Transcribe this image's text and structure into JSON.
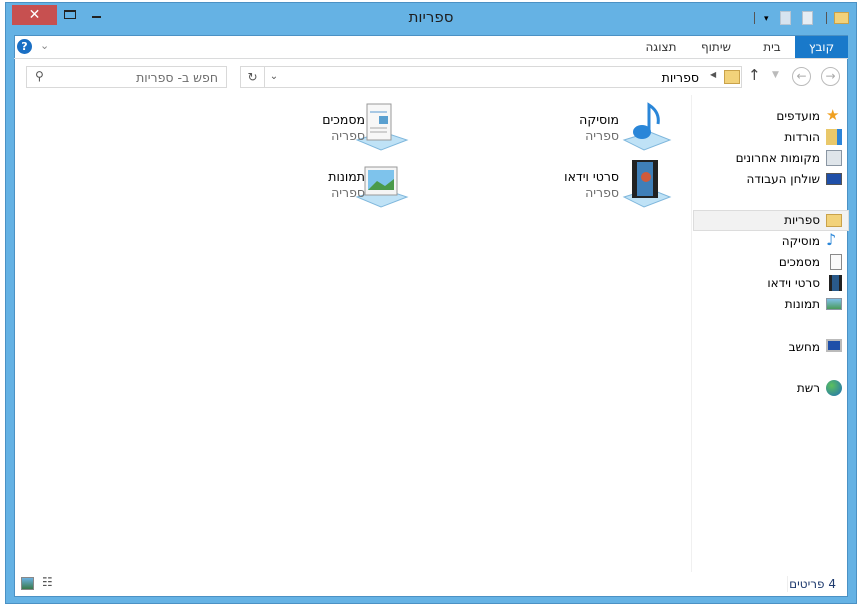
{
  "window": {
    "title": "ספריות",
    "close": "✕"
  },
  "ribbon": {
    "tabs": [
      "קובץ",
      "בית",
      "שיתוף",
      "תצוגה"
    ]
  },
  "address": {
    "path": "ספריות",
    "search_placeholder": "חפש ב- ספריות"
  },
  "nav": {
    "favorites": [
      "מועדפים",
      "הורדות",
      "מקומות אחרונים",
      "שולחן העבודה"
    ],
    "libraries": [
      "ספריות",
      "מוסיקה",
      "מסמכים",
      "סרטי וידאו",
      "תמונות"
    ],
    "computer": "מחשב",
    "network": "רשת"
  },
  "items": [
    {
      "name": "מוסיקה",
      "type": "ספריה"
    },
    {
      "name": "מסמכים",
      "type": "ספריה"
    },
    {
      "name": "סרטי וידאו",
      "type": "ספריה"
    },
    {
      "name": "תמונות",
      "type": "ספריה"
    }
  ],
  "status": {
    "count": "4 פריטים"
  }
}
